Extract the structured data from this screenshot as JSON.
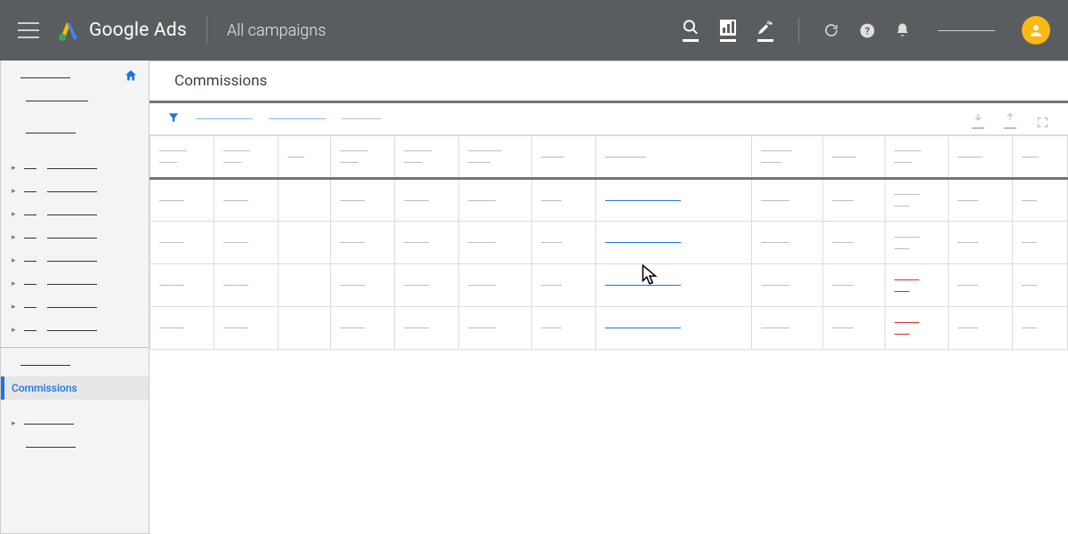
{
  "header": {
    "product": "Google Ads",
    "scope": "All campaigns"
  },
  "sidebar": {
    "active_label": "Commissions"
  },
  "page": {
    "title": "Commissions"
  },
  "table": {
    "columns": 13,
    "rows": 4
  }
}
